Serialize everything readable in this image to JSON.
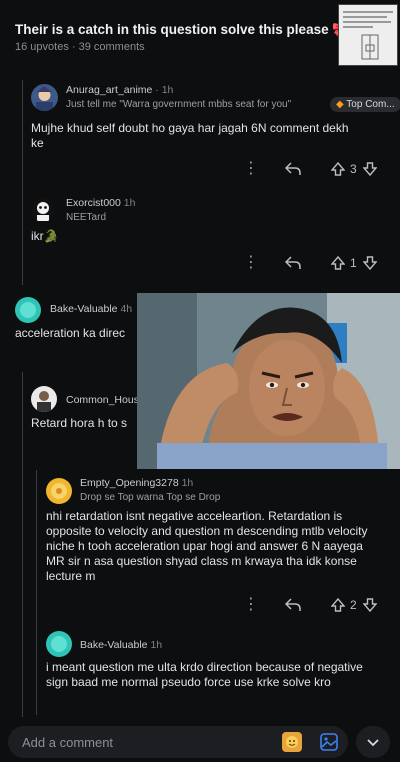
{
  "post": {
    "title": "Their is a catch in this question solve this please 🎀",
    "meta": "16 upvotes · 39 comments"
  },
  "comments": [
    {
      "username": "Anurag_art_anime",
      "time": " · 1h",
      "flair": "Just tell me \"Warra government mbbs seat for you\"",
      "badge": "Top Com...",
      "text": "Mujhe khud self doubt ho gaya har jagah 6N comment dekh ke",
      "votes": "3"
    },
    {
      "username": "Exorcist000",
      "time": " 1h",
      "flair": "NEETard",
      "text": "ikr🐊",
      "votes": "1"
    },
    {
      "username": "Bake-Valuable",
      "time": " 4h",
      "text": "acceleration ka direc"
    },
    {
      "username": "Common_Hous",
      "text": "Retard hora h to s"
    },
    {
      "username": "Empty_Opening3278",
      "time": " 1h",
      "flair": "Drop se Top warna Top se Drop",
      "text": "nhi retardation isnt negative acceleartion. Retardation is opposite to velocity and question m descending mtlb velocity niche h tooh acceleration upar hogi and answer 6 N aayega MR sir n asa question shyad class m krwaya tha idk konse lecture m",
      "votes": "2"
    },
    {
      "username": "Bake-Valuable",
      "time": " 1h",
      "text": "i meant question me ulta krdo direction because of negative sign baad me normal pseudo force use krke solve kro"
    }
  ],
  "composer": {
    "placeholder": "Add a comment"
  },
  "icons": {
    "more": "more-icon",
    "reply": "reply-icon",
    "upvote": "upvote-icon",
    "downvote": "downvote-icon",
    "emoji": "emoji-icon",
    "image": "image-icon",
    "chevron": "chevron-down-icon"
  }
}
